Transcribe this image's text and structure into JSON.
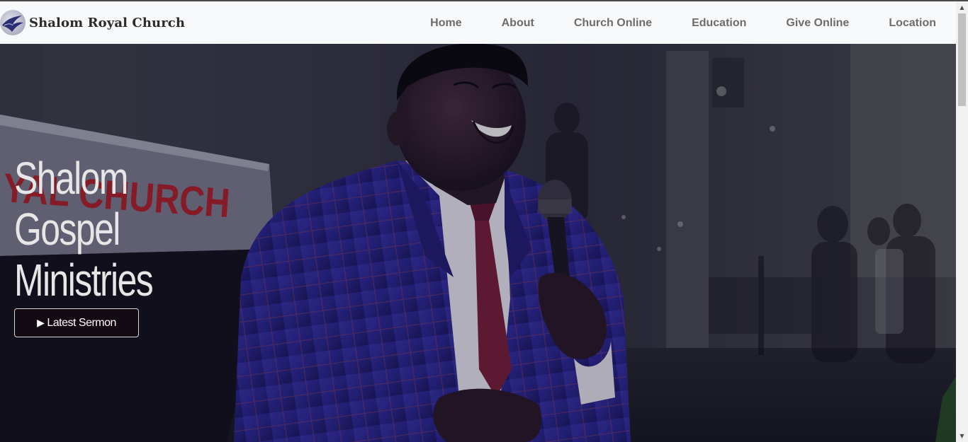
{
  "brand": {
    "name": "Shalom Royal Church",
    "logo_icon": "dove-icon"
  },
  "nav": {
    "items": [
      {
        "label": "Home"
      },
      {
        "label": "About"
      },
      {
        "label": "Church Online"
      },
      {
        "label": "Education"
      },
      {
        "label": "Give Online"
      },
      {
        "label": "Location"
      }
    ]
  },
  "hero": {
    "title_lines": [
      "Shalom",
      "Gospel",
      "Ministries"
    ],
    "pulpit_text": "YAL CHURCH",
    "button": {
      "icon": "play-icon",
      "icon_glyph": "▶",
      "label": "Latest Sermon"
    }
  },
  "colors": {
    "navbar_bg": "#f8f9fa",
    "nav_text": "#6c6c6c",
    "brand_text": "#2b2b2b",
    "hero_text": "#e6e6e6",
    "suit_blue": "#2f2a8a",
    "tie_red": "#7a1f3a"
  }
}
